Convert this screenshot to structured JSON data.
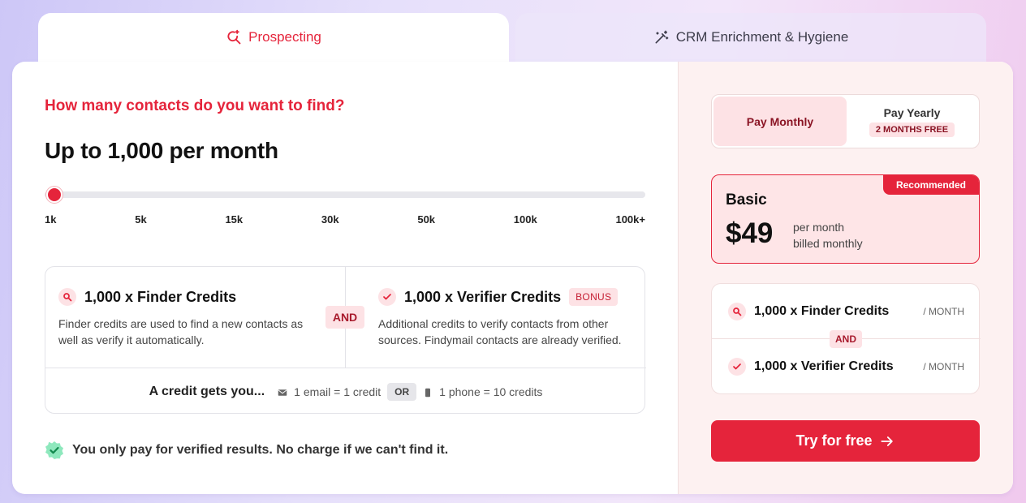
{
  "tabs": [
    {
      "label": "Prospecting",
      "icon": "search-sparkle-icon",
      "active": true
    },
    {
      "label": "CRM Enrichment & Hygiene",
      "icon": "magic-wand-icon",
      "active": false
    }
  ],
  "finder": {
    "question": "How many contacts do you want to find?",
    "amount": "Up to 1,000 per month",
    "slider": {
      "ticks": [
        "1k",
        "5k",
        "15k",
        "30k",
        "50k",
        "100k",
        "100k+"
      ],
      "selected_index": 0
    },
    "credits": {
      "finder": {
        "title": "1,000 x Finder Credits",
        "description": "Finder credits are used to find a new contacts as well as verify it automatically."
      },
      "and_label": "AND",
      "verifier": {
        "title": "1,000 x Verifier Credits",
        "badge": "BONUS",
        "description": "Additional credits to verify contacts from other sources. Findymail contacts are already verified."
      },
      "footer": {
        "label": "A credit gets you...",
        "email": "1 email = 1 credit",
        "or": "OR",
        "phone": "1 phone = 10 credits"
      }
    },
    "guarantee": "You only pay for verified results. No charge if we can't find it."
  },
  "billing": {
    "monthly_label": "Pay Monthly",
    "yearly_label": "Pay Yearly",
    "yearly_badge": "2 MONTHS FREE",
    "selected": "monthly"
  },
  "plan": {
    "badge": "Recommended",
    "name": "Basic",
    "price": "$49",
    "period_line1": "per month",
    "period_line2": "billed monthly"
  },
  "summary": {
    "finder": "1,000 x Finder Credits",
    "finder_per": "/ MONTH",
    "and_label": "AND",
    "verifier": "1,000 x Verifier Credits",
    "verifier_per": "/ MONTH"
  },
  "cta": {
    "label": "Try for free"
  },
  "colors": {
    "accent": "#e5243b",
    "accent_soft": "#fde2e5",
    "right_panel": "#fdf1f1",
    "success": "#3ecf8e"
  }
}
